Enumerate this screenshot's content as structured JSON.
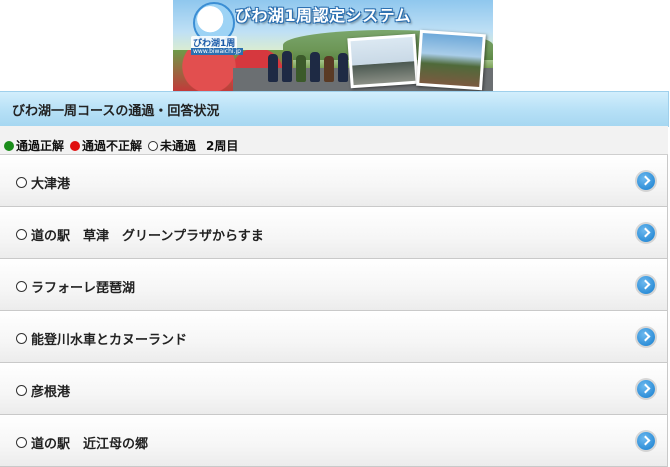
{
  "banner": {
    "title": "びわ湖1周認定システム",
    "logo_text": "びわ湖1周",
    "logo_sub": "www.biwaichi.jp"
  },
  "section": {
    "title": "びわ湖一周コースの通過・回答状況"
  },
  "legend": {
    "passed_correct": "通過正解",
    "passed_incorrect": "通過不正解",
    "not_passed": "未通過",
    "lap": "2周目",
    "colors": {
      "correct": "#1a8c1a",
      "incorrect": "#e01010"
    }
  },
  "checkpoints": [
    {
      "label": "大津港",
      "status": "not_passed"
    },
    {
      "label": "道の駅　草津　グリーンプラザからすま",
      "status": "not_passed"
    },
    {
      "label": "ラフォーレ琵琶湖",
      "status": "not_passed"
    },
    {
      "label": "能登川水車とカヌーランド",
      "status": "not_passed"
    },
    {
      "label": "彦根港",
      "status": "not_passed"
    },
    {
      "label": "道の駅　近江母の郷",
      "status": "not_passed"
    }
  ],
  "icons": {
    "status_not_passed": "white-circle-icon",
    "item_arrow": "chevron-right-circle-icon"
  }
}
